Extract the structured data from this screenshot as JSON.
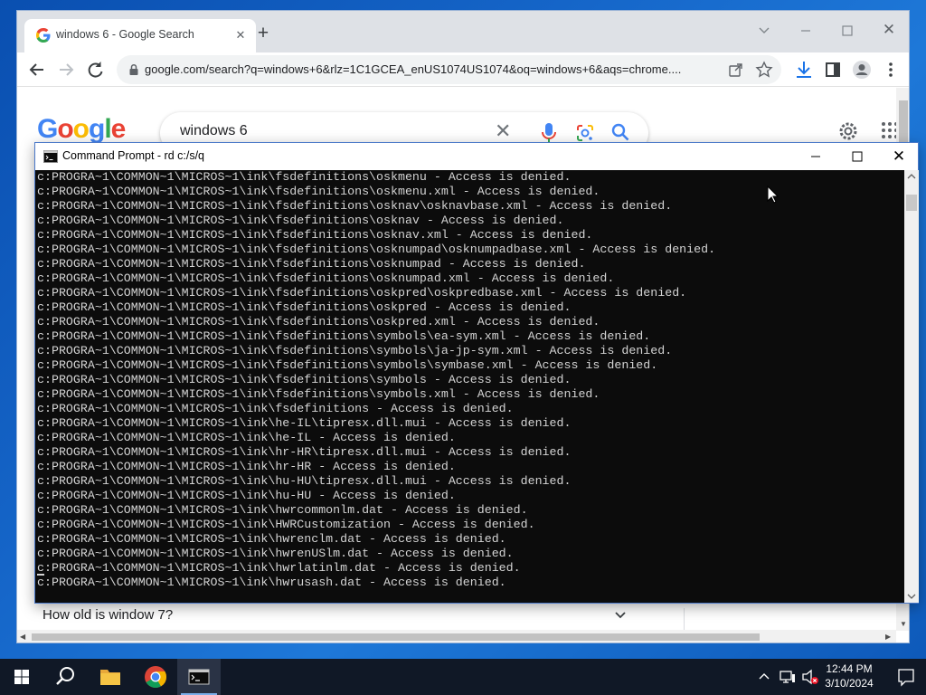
{
  "chrome": {
    "tab_title": "windows 6 - Google Search",
    "url": "google.com/search?q=windows+6&rlz=1C1GCEA_enUS1074US1074&oq=windows+6&aqs=chrome....",
    "google_logo": "Google",
    "search_query": "windows 6",
    "related_question": "How old is window 7?"
  },
  "cmd": {
    "title": "Command Prompt - rd  c:/s/q",
    "lines": [
      "c:PROGRA~1\\COMMON~1\\MICROS~1\\ink\\fsdefinitions\\oskmenu - Access is denied.",
      "c:PROGRA~1\\COMMON~1\\MICROS~1\\ink\\fsdefinitions\\oskmenu.xml - Access is denied.",
      "c:PROGRA~1\\COMMON~1\\MICROS~1\\ink\\fsdefinitions\\osknav\\osknavbase.xml - Access is denied.",
      "c:PROGRA~1\\COMMON~1\\MICROS~1\\ink\\fsdefinitions\\osknav - Access is denied.",
      "c:PROGRA~1\\COMMON~1\\MICROS~1\\ink\\fsdefinitions\\osknav.xml - Access is denied.",
      "c:PROGRA~1\\COMMON~1\\MICROS~1\\ink\\fsdefinitions\\osknumpad\\osknumpadbase.xml - Access is denied.",
      "c:PROGRA~1\\COMMON~1\\MICROS~1\\ink\\fsdefinitions\\osknumpad - Access is denied.",
      "c:PROGRA~1\\COMMON~1\\MICROS~1\\ink\\fsdefinitions\\osknumpad.xml - Access is denied.",
      "c:PROGRA~1\\COMMON~1\\MICROS~1\\ink\\fsdefinitions\\oskpred\\oskpredbase.xml - Access is denied.",
      "c:PROGRA~1\\COMMON~1\\MICROS~1\\ink\\fsdefinitions\\oskpred - Access is denied.",
      "c:PROGRA~1\\COMMON~1\\MICROS~1\\ink\\fsdefinitions\\oskpred.xml - Access is denied.",
      "c:PROGRA~1\\COMMON~1\\MICROS~1\\ink\\fsdefinitions\\symbols\\ea-sym.xml - Access is denied.",
      "c:PROGRA~1\\COMMON~1\\MICROS~1\\ink\\fsdefinitions\\symbols\\ja-jp-sym.xml - Access is denied.",
      "c:PROGRA~1\\COMMON~1\\MICROS~1\\ink\\fsdefinitions\\symbols\\symbase.xml - Access is denied.",
      "c:PROGRA~1\\COMMON~1\\MICROS~1\\ink\\fsdefinitions\\symbols - Access is denied.",
      "c:PROGRA~1\\COMMON~1\\MICROS~1\\ink\\fsdefinitions\\symbols.xml - Access is denied.",
      "c:PROGRA~1\\COMMON~1\\MICROS~1\\ink\\fsdefinitions - Access is denied.",
      "c:PROGRA~1\\COMMON~1\\MICROS~1\\ink\\he-IL\\tipresx.dll.mui - Access is denied.",
      "c:PROGRA~1\\COMMON~1\\MICROS~1\\ink\\he-IL - Access is denied.",
      "c:PROGRA~1\\COMMON~1\\MICROS~1\\ink\\hr-HR\\tipresx.dll.mui - Access is denied.",
      "c:PROGRA~1\\COMMON~1\\MICROS~1\\ink\\hr-HR - Access is denied.",
      "c:PROGRA~1\\COMMON~1\\MICROS~1\\ink\\hu-HU\\tipresx.dll.mui - Access is denied.",
      "c:PROGRA~1\\COMMON~1\\MICROS~1\\ink\\hu-HU - Access is denied.",
      "c:PROGRA~1\\COMMON~1\\MICROS~1\\ink\\hwrcommonlm.dat - Access is denied.",
      "c:PROGRA~1\\COMMON~1\\MICROS~1\\ink\\HWRCustomization - Access is denied.",
      "c:PROGRA~1\\COMMON~1\\MICROS~1\\ink\\hwrenclm.dat - Access is denied.",
      "c:PROGRA~1\\COMMON~1\\MICROS~1\\ink\\hwrenUSlm.dat - Access is denied.",
      "c:PROGRA~1\\COMMON~1\\MICROS~1\\ink\\hwrlatinlm.dat - Access is denied.",
      "c:PROGRA~1\\COMMON~1\\MICROS~1\\ink\\hwrusash.dat - Access is denied."
    ]
  },
  "taskbar": {
    "time": "12:44 PM",
    "date": "3/10/2024"
  },
  "icons": {
    "start": "windows-logo-icon",
    "search": "search-icon",
    "explorer": "folder-icon",
    "chrome": "chrome-icon",
    "cmd": "terminal-icon"
  },
  "colors": {
    "desktop": "#1565c8",
    "console_bg": "#0c0c0c",
    "console_text": "#d4d4d4",
    "taskbar": "#101826"
  }
}
